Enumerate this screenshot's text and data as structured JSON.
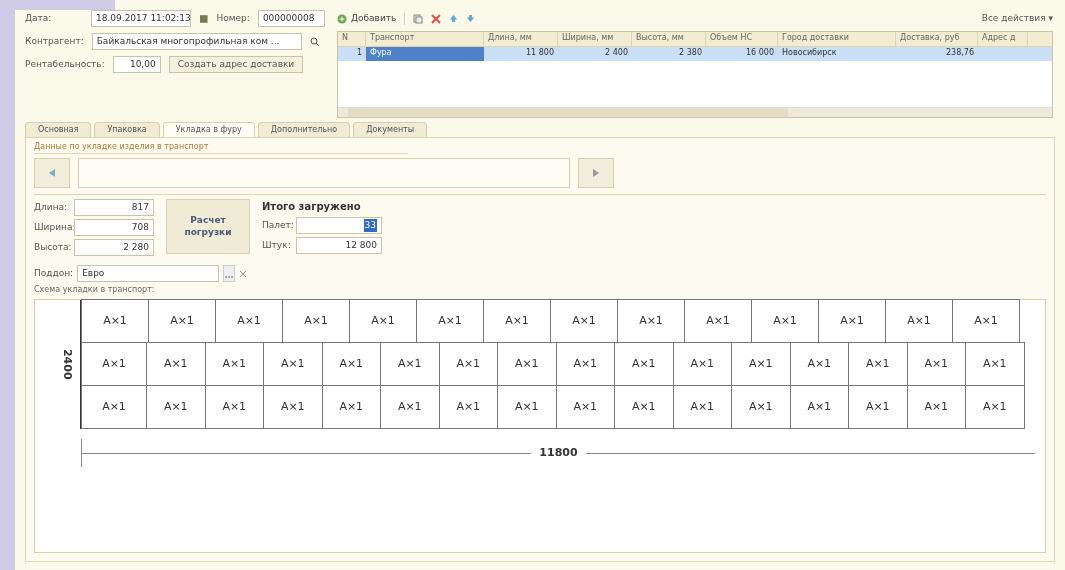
{
  "header": {
    "date_label": "Дата:",
    "date": "18.09.2017 11:02:13",
    "number_label": "Номер:",
    "number": "000000008",
    "counterparty_label": "Контрагент:",
    "counterparty": "Байкальская многопрофильная ком ...",
    "profit_label": "Рентабельность:",
    "profit": "10,00",
    "create_address": "Создать адрес доставки"
  },
  "toolbar": {
    "add": "Добавить",
    "all_actions": "Все действия ▾"
  },
  "table": {
    "columns": [
      "N",
      "Транспорт",
      "Длина, мм",
      "Ширина, мм",
      "Высота, мм",
      "Объем НС",
      "Город доставки",
      "Доставка, руб",
      "Адрес д"
    ],
    "rows": [
      {
        "selected": true,
        "cells": [
          "1",
          "Фура",
          "11 800",
          "2 400",
          "2 380",
          "16 000",
          "Новосибирск",
          "238,76",
          ""
        ]
      }
    ]
  },
  "tabs": [
    {
      "label": "Основная",
      "selected": false
    },
    {
      "label": "Упаковка",
      "selected": false
    },
    {
      "label": "Укладка в фуру",
      "selected": true
    },
    {
      "label": "Дополнительно",
      "selected": false
    },
    {
      "label": "Документы",
      "selected": false
    }
  ],
  "group_title": "Данные по укладке изделия в транспорт",
  "dims": [
    {
      "label": "Длина:",
      "value": "817"
    },
    {
      "label": "Ширина:",
      "value": "708"
    },
    {
      "label": "Высота:",
      "value": "2 280"
    }
  ],
  "calc_button": "Расчет погрузки",
  "totals": {
    "title": "Итого загружено",
    "items": [
      {
        "label": "Палет:",
        "value": "33",
        "selected": true
      },
      {
        "label": "Штук:",
        "value": "12 800",
        "selected": false
      }
    ]
  },
  "pallet": {
    "label": "Поддон:",
    "value": "Евро"
  },
  "scheme_title": "Схема укладки в транспорт:",
  "scheme": {
    "height_label": "2400",
    "length_label": "11800",
    "tiers": [
      {
        "pallets": [
          "A×1",
          "A×1",
          "A×1",
          "A×1",
          "A×1",
          "A×1",
          "A×1",
          "A×1",
          "A×1",
          "A×1",
          "A×1",
          "A×1",
          "A×1",
          "A×1"
        ]
      },
      {
        "pallets": [
          "A×1",
          "A×1",
          "A×1",
          "A×1",
          "A×1",
          "A×1",
          "A×1",
          "A×1",
          "A×1",
          "A×1",
          "A×1",
          "A×1",
          "A×1",
          "A×1",
          "A×1",
          "A×1"
        ]
      },
      {
        "pallets": [
          "A×1",
          "A×1",
          "A×1",
          "A×1",
          "A×1",
          "A×1",
          "A×1",
          "A×1",
          "A×1",
          "A×1",
          "A×1",
          "A×1",
          "A×1",
          "A×1",
          "A×1",
          "A×1"
        ]
      }
    ]
  }
}
